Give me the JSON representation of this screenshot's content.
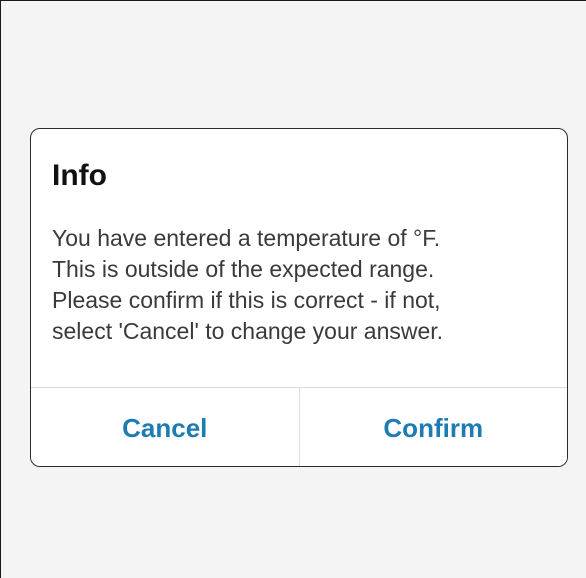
{
  "dialog": {
    "title": "Info",
    "message_lines": [
      "You have entered a temperature of  °F.",
      "This is outside of the expected range.",
      "Please confirm if this is correct - if not,",
      "select 'Cancel' to change your answer."
    ],
    "cancel_label": "Cancel",
    "confirm_label": "Confirm"
  },
  "colors": {
    "background": "#f4f4f4",
    "dialog_background": "#ffffff",
    "button_text": "#1e7bb3",
    "divider": "#dcdcdc"
  }
}
